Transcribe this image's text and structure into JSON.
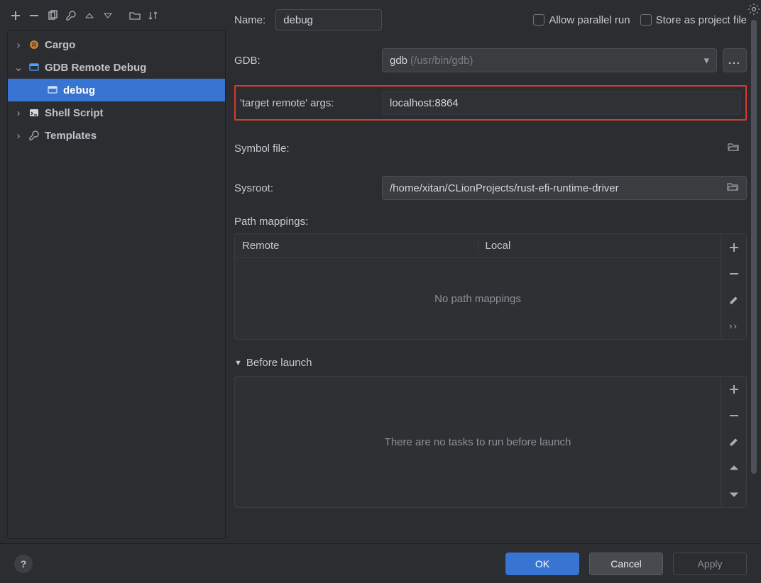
{
  "toolbar": {
    "add_tip": "Add",
    "remove_tip": "Remove",
    "copy_tip": "Copy",
    "edit_tip": "Edit",
    "up_tip": "Move Up",
    "down_tip": "Move Down",
    "folder_tip": "Save",
    "sort_tip": "Sort"
  },
  "tree": {
    "items": [
      {
        "type": "group",
        "label": "Cargo",
        "expanded": false,
        "icon": "cargo"
      },
      {
        "type": "group",
        "label": "GDB Remote Debug",
        "expanded": true,
        "icon": "runconfig"
      },
      {
        "type": "leaf",
        "label": "debug",
        "selected": true,
        "icon": "runconfig"
      },
      {
        "type": "group",
        "label": "Shell Script",
        "expanded": false,
        "icon": "shell"
      },
      {
        "type": "group",
        "label": "Templates",
        "expanded": false,
        "icon": "wrench"
      }
    ]
  },
  "header": {
    "name_label": "Name:",
    "name_value": "debug",
    "allow_parallel_label": "Allow parallel run",
    "store_as_project_label": "Store as project file",
    "gear_tip": "Options"
  },
  "gdb": {
    "label": "GDB:",
    "value": "gdb",
    "hint": "(/usr/bin/gdb)",
    "more_label": "..."
  },
  "target_remote": {
    "label": "'target remote' args:",
    "value": "localhost:8864"
  },
  "symbol_file": {
    "label": "Symbol file:",
    "value": ""
  },
  "sysroot": {
    "label": "Sysroot:",
    "value": "/home/xitan/CLionProjects/rust-efi-runtime-driver"
  },
  "path_mappings": {
    "label": "Path mappings:",
    "cols": {
      "remote": "Remote",
      "local": "Local"
    },
    "empty": "No path mappings"
  },
  "before_launch": {
    "label": "Before launch",
    "empty": "There are no tasks to run before launch"
  },
  "footer": {
    "help": "?",
    "ok": "OK",
    "cancel": "Cancel",
    "apply": "Apply"
  }
}
